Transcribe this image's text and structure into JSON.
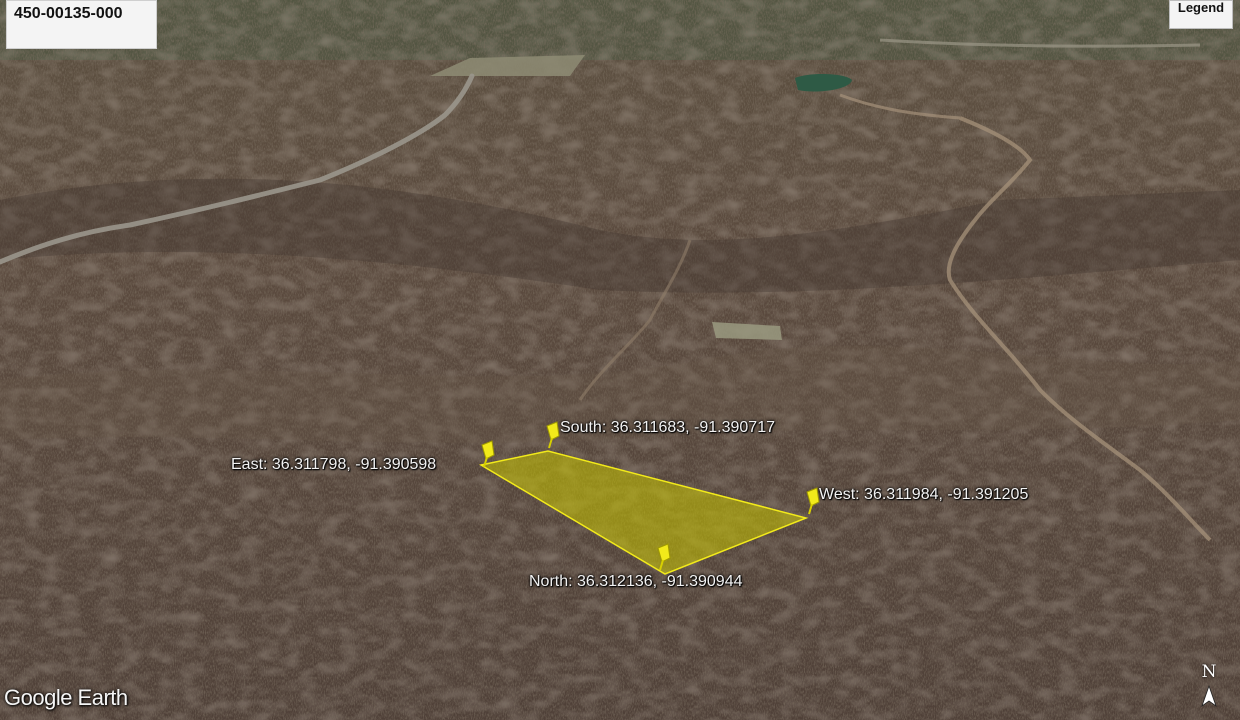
{
  "parcel_id": "450-00135-000",
  "legend_button": "Legend",
  "markers": {
    "south": "South: 36.311683, -91.390717",
    "east": "East: 36.311798, -91.390598",
    "west": "West: 36.311984, -91.391205",
    "north": "North: 36.312136, -91.390944"
  },
  "logo": "Google Earth",
  "compass": "N",
  "colors": {
    "parcel_fill": "#c8c400",
    "pin": "#f2ea1a",
    "terrain": "#5a4b40"
  }
}
